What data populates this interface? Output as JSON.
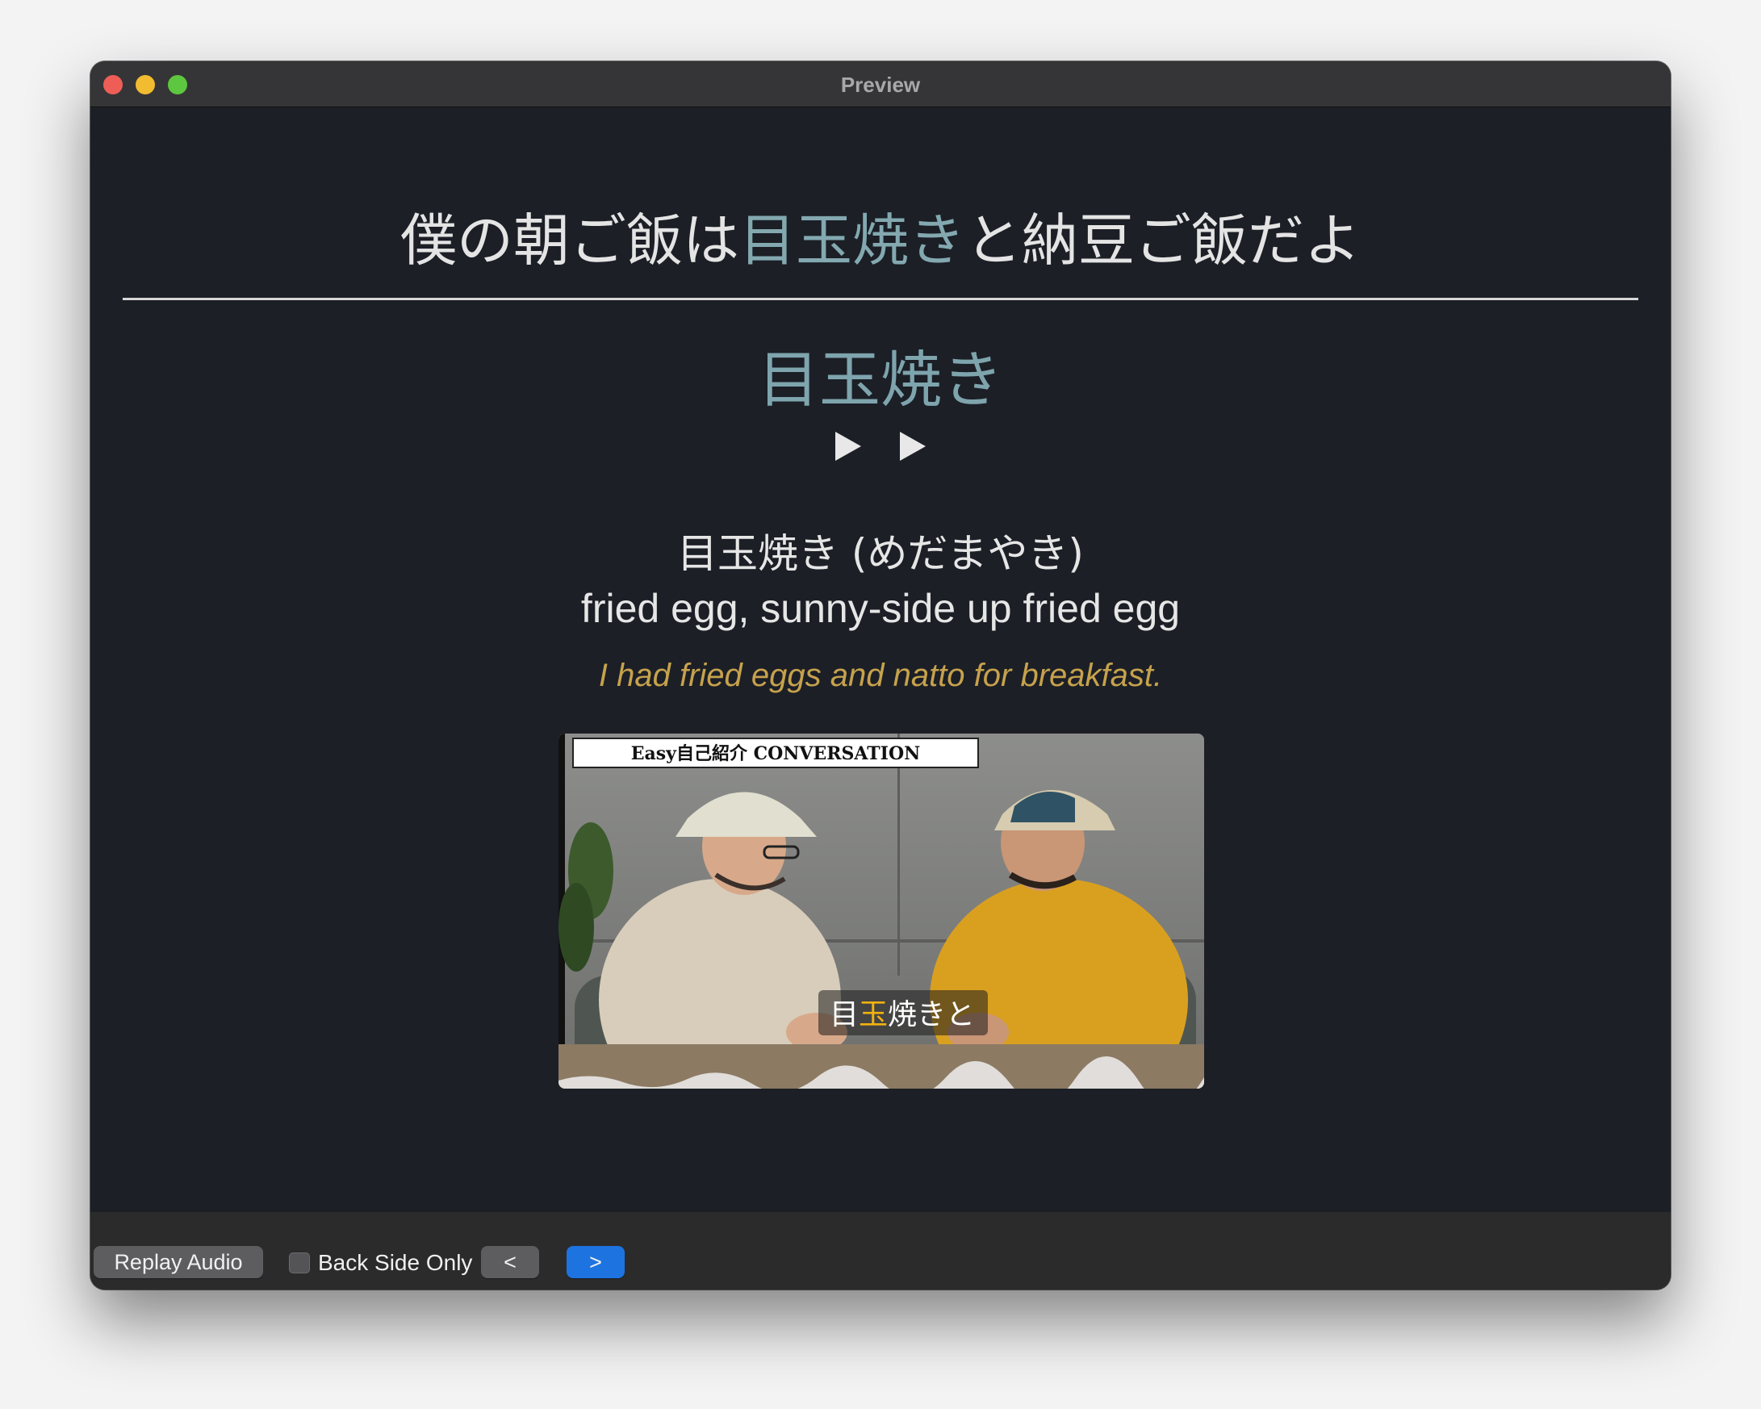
{
  "window": {
    "title": "Preview"
  },
  "card": {
    "sentence_before": "僕の朝ご飯は",
    "sentence_highlight": "目玉焼き",
    "sentence_after": "と納豆ご飯だよ",
    "word": "目玉焼き",
    "play_icons": [
      "play-icon",
      "play-icon"
    ],
    "reading": "目玉焼き (めだまやき)",
    "meaning": "fried egg, sunny-side up fried egg",
    "example_translation": "I had fried eggs and natto for breakfast."
  },
  "thumbnail": {
    "banner": "Easy自己紹介 CONVERSATION",
    "subtitle_pre": "目",
    "subtitle_highlight": "玉",
    "subtitle_post": "焼きと"
  },
  "controls": {
    "replay_label": "Replay Audio",
    "back_side_label": "Back Side Only",
    "back_side_checked": false,
    "prev_label": "<",
    "next_label": ">"
  },
  "colors": {
    "background": "#1c1f26",
    "highlight": "#7ea4ad",
    "example": "#c6a24c",
    "accent_button": "#1d73e0"
  }
}
